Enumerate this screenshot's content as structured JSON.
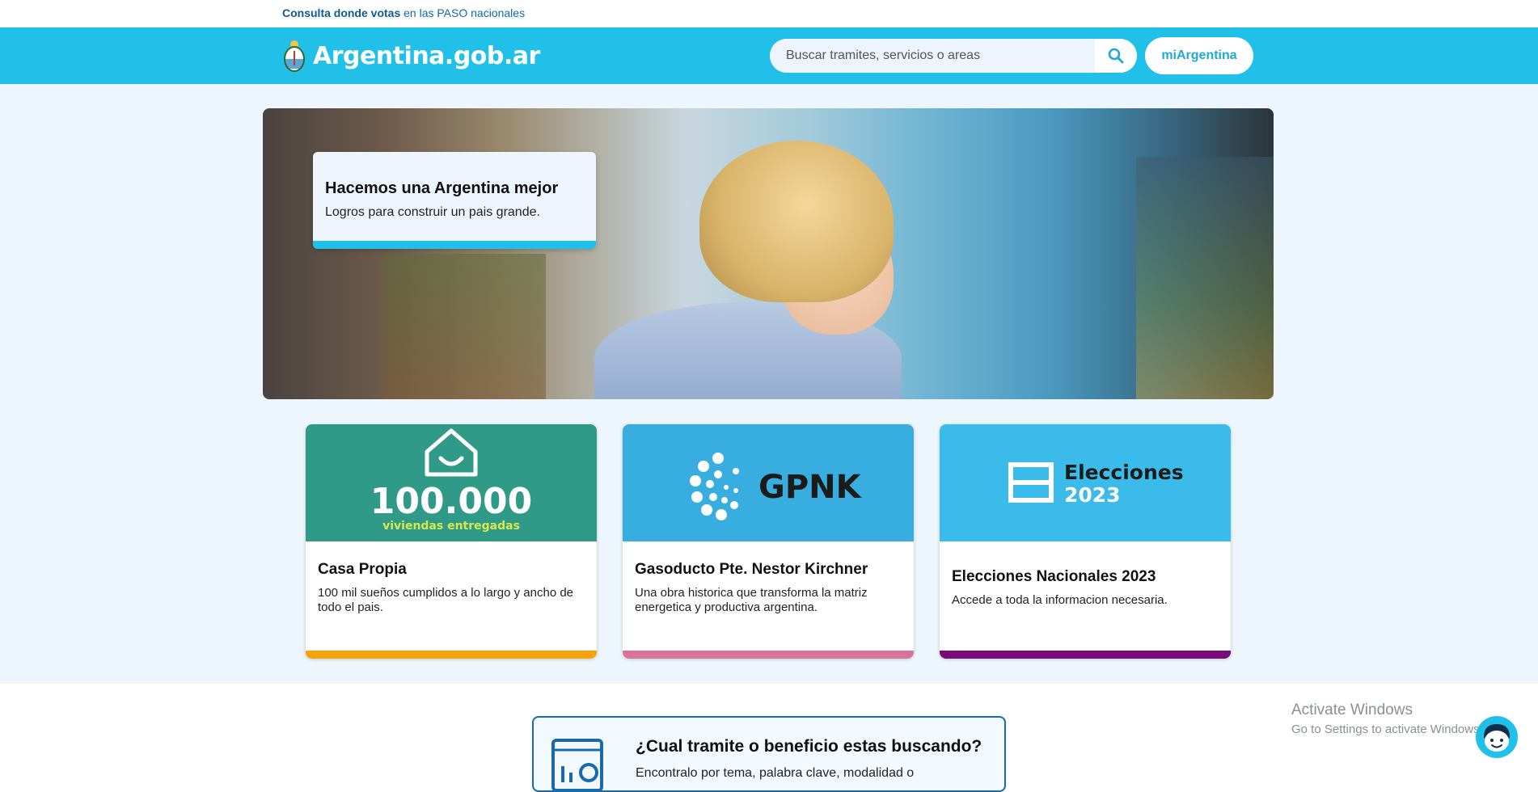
{
  "top_notice": {
    "bold": "Consulta donde votas",
    "rest": " en las PASO nacionales"
  },
  "header": {
    "site_name": "Argentina.gob.ar",
    "search_placeholder": "Buscar tramites, servicios o areas",
    "mi_button": "miArgentina",
    "bg_color": "#21c0e8"
  },
  "hero": {
    "title": "Hacemos una Argentina mejor",
    "subtitle": "Logros para construir un pais grande."
  },
  "cards": [
    {
      "image_number": "100.000",
      "image_caption": "viviendas entregadas",
      "title": "Casa Propia",
      "text": "100 mil sueños cumplidos a lo largo y ancho de todo el pais.",
      "image_color": "#2f9a87",
      "foot_color": "#f7a20b"
    },
    {
      "image_label": "GPNK",
      "title": "Gasoducto Pte. Nestor Kirchner",
      "text": "Una obra historica que transforma la matriz energetica y productiva argentina.",
      "image_color": "#38aee0",
      "foot_color": "#d9739a"
    },
    {
      "image_line1": "Elecciones",
      "image_line2": "2023",
      "title": "Elecciones Nacionales 2023",
      "text": "Accede a toda la informacion necesaria.",
      "image_color": "#3bbbea",
      "foot_color": "#7a0a77"
    }
  ],
  "finder": {
    "title": "¿Cual tramite o beneficio estas buscando?",
    "text": "Encontralo por tema, palabra clave, modalidad o"
  },
  "watermark": {
    "line1": "Activate Windows",
    "line2": "Go to Settings to activate Windows."
  }
}
